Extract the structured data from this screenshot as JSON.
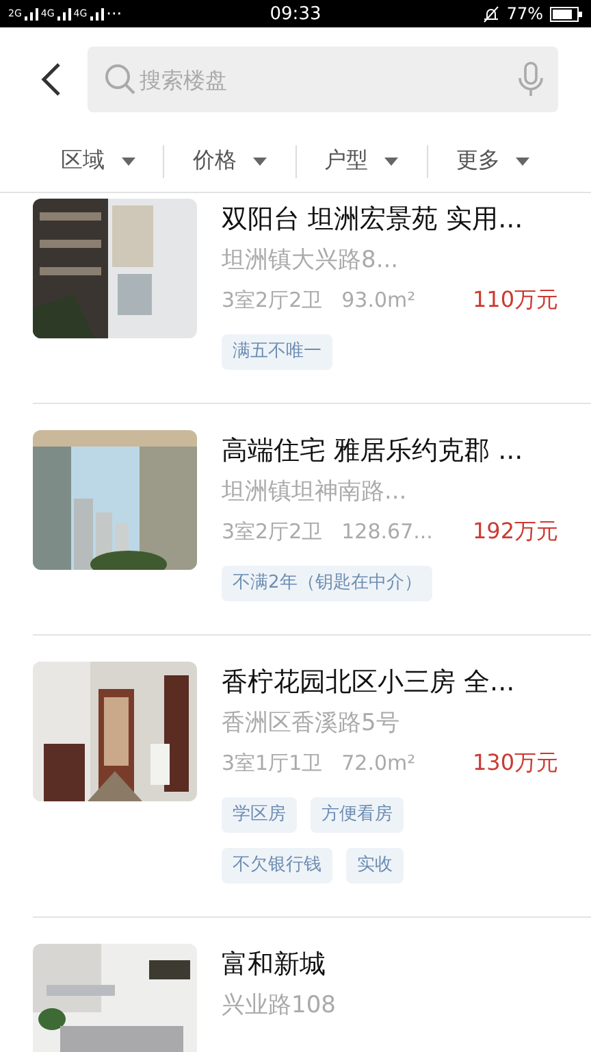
{
  "status_bar": {
    "network_labels": [
      "2G",
      "4G",
      "4G"
    ],
    "more": "···",
    "time": "09:33",
    "battery_text": "77%"
  },
  "search": {
    "placeholder": "搜索楼盘"
  },
  "filters": [
    {
      "label": "区域"
    },
    {
      "label": "价格"
    },
    {
      "label": "户型"
    },
    {
      "label": "更多"
    }
  ],
  "listings": [
    {
      "image": {
        "kind": "picture"
      },
      "title": "双阳台 坦洲宏景苑 实用...",
      "address": "坦洲镇大兴路8...",
      "layout": "3室2厅2卫",
      "area": "93.0m²",
      "price": "110万元",
      "tags": [
        [
          "满五不唯一"
        ]
      ]
    },
    {
      "image": {
        "kind": "picture"
      },
      "title": "高端住宅 雅居乐约克郡 ...",
      "address": "坦洲镇坦神南路...",
      "layout": "3室2厅2卫",
      "area": "128.67...",
      "price": "192万元",
      "tags": [
        [
          "不满2年（钥匙在中介）"
        ]
      ]
    },
    {
      "image": {
        "kind": "picture"
      },
      "title": "香柠花园北区小三房 全...",
      "address": "香洲区香溪路5号",
      "layout": "3室1厅1卫",
      "area": "72.0m²",
      "price": "130万元",
      "tags": [
        [
          "学区房",
          "方便看房"
        ],
        [
          "不欠银行钱",
          "实收"
        ]
      ]
    },
    {
      "image": {
        "kind": "picture"
      },
      "title": "富和新城",
      "address": "兴业路108"
    }
  ]
}
